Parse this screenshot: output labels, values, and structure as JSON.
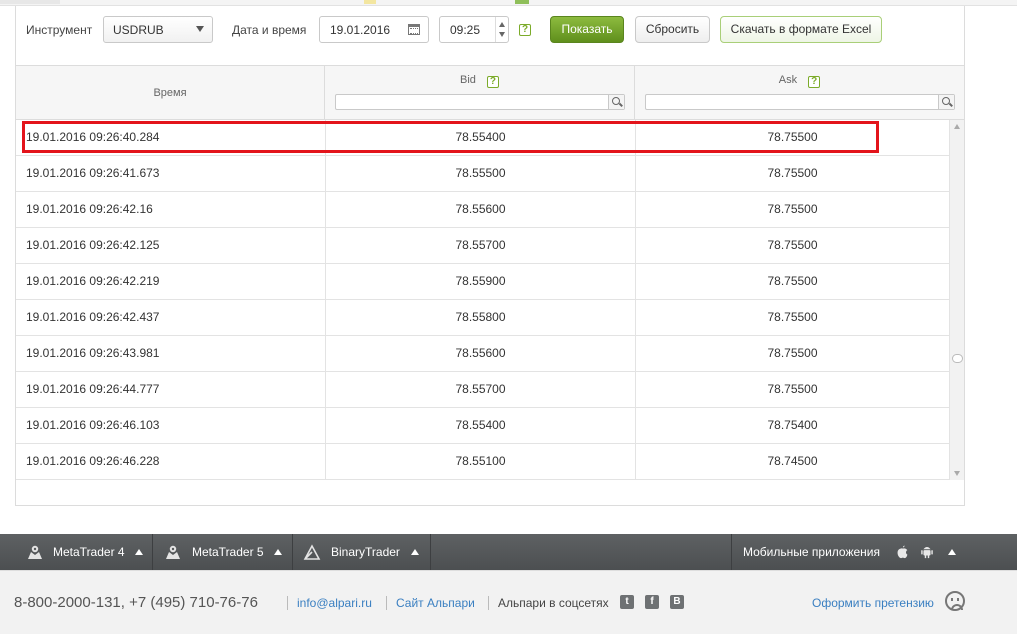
{
  "filters": {
    "instrument_label": "Инструмент",
    "instrument_value": "USDRUB",
    "datetime_label": "Дата и время",
    "date_value": "19.01.2016",
    "time_value": "09:25",
    "help_mark": "?",
    "show_button": "Показать",
    "reset_button": "Сбросить",
    "excel_button": "Скачать в формате Excel"
  },
  "table": {
    "columns": {
      "time": "Время",
      "bid": "Bid",
      "ask": "Ask"
    },
    "rows": [
      {
        "time": "19.01.2016 09:26:40.284",
        "bid": "78.55400",
        "ask": "78.75500"
      },
      {
        "time": "19.01.2016 09:26:41.673",
        "bid": "78.55500",
        "ask": "78.75500"
      },
      {
        "time": "19.01.2016 09:26:42.16",
        "bid": "78.55600",
        "ask": "78.75500"
      },
      {
        "time": "19.01.2016 09:26:42.125",
        "bid": "78.55700",
        "ask": "78.75500"
      },
      {
        "time": "19.01.2016 09:26:42.219",
        "bid": "78.55900",
        "ask": "78.75500"
      },
      {
        "time": "19.01.2016 09:26:42.437",
        "bid": "78.55800",
        "ask": "78.75500"
      },
      {
        "time": "19.01.2016 09:26:43.981",
        "bid": "78.55600",
        "ask": "78.75500"
      },
      {
        "time": "19.01.2016 09:26:44.777",
        "bid": "78.55700",
        "ask": "78.75500"
      },
      {
        "time": "19.01.2016 09:26:46.103",
        "bid": "78.55400",
        "ask": "78.75400"
      },
      {
        "time": "19.01.2016 09:26:46.228",
        "bid": "78.55100",
        "ask": "78.74500"
      }
    ],
    "highlight_color": "#e3141b"
  },
  "platform_bar": {
    "mt4": "MetaTrader 4",
    "mt5": "MetaTrader 5",
    "binary": "BinaryTrader",
    "mobile": "Мобильные приложения"
  },
  "footer": {
    "phones": "8-800-2000-131, +7 (495) 710-76-76",
    "email": "info@alpari.ru",
    "site": "Сайт Альпари",
    "social": "Альпари в соцсетях",
    "social_twitter": "t",
    "social_facebook": "f",
    "social_vk": "B",
    "complaint": "Оформить претензию"
  },
  "colors": {
    "accent_green": "#6a9a24",
    "link_blue": "#3a7fc1",
    "bar_dark": "#56595b"
  }
}
